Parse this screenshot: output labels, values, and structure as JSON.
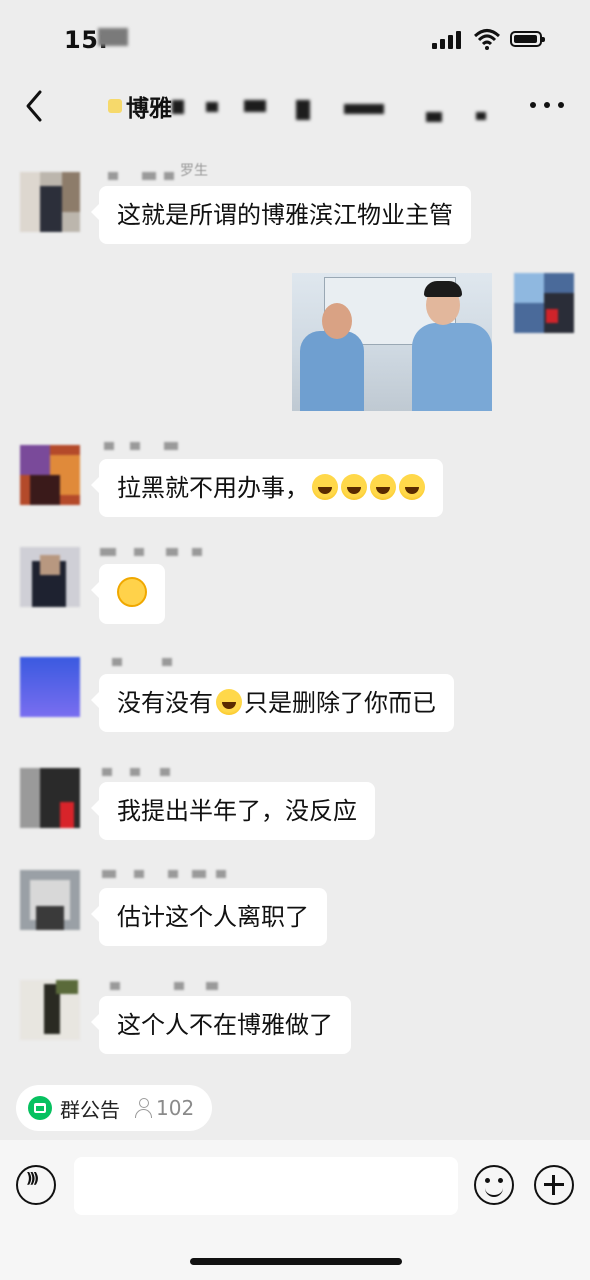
{
  "status_bar": {
    "time": "15:"
  },
  "nav": {
    "title": "博雅"
  },
  "messages": [
    {
      "name_suffix": "罗生",
      "text": "这就是所谓的博雅滨江物业主管"
    },
    {
      "text": "拉黑就不用办事，"
    },
    {
      "text": ""
    },
    {
      "text": "没有没有",
      "text_after": "只是删除了你而已"
    },
    {
      "text": "我提出半年了，没反应"
    },
    {
      "text": "估计这个人离职了"
    },
    {
      "text": "这个人不在博雅做了"
    }
  ],
  "notice": {
    "label": "群公告",
    "member_count": "102"
  },
  "input": {
    "placeholder": ""
  },
  "colors": {
    "accent": "#07c160",
    "background": "#ededed",
    "bubble": "#ffffff"
  },
  "icons": [
    "back-icon",
    "more-icon",
    "voice-icon",
    "emoji-icon",
    "plus-icon",
    "notice-icon",
    "person-icon",
    "laugh-emoji",
    "thinking-emoji"
  ]
}
